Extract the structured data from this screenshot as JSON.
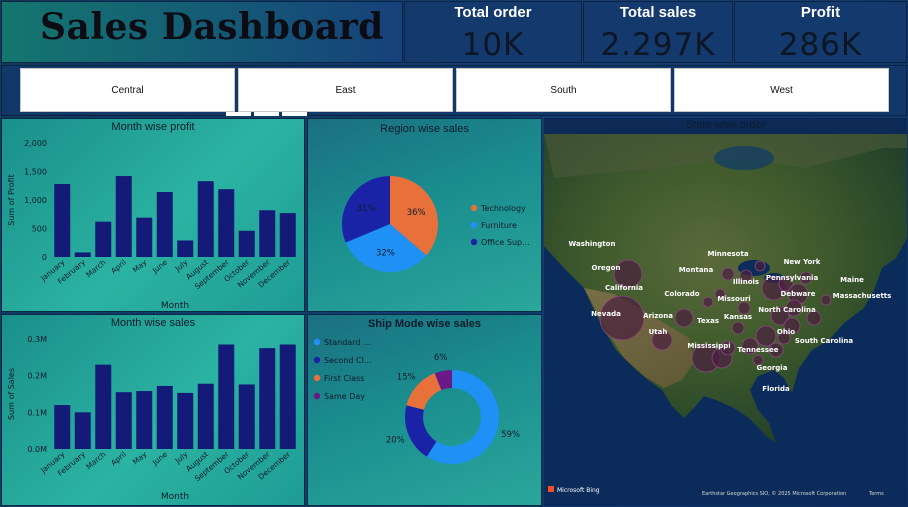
{
  "header": {
    "title": "Sales Dashboard"
  },
  "kpis": [
    {
      "label": "Total order",
      "value": "10K"
    },
    {
      "label": "Total sales",
      "value": "2.297K"
    },
    {
      "label": "Profit",
      "value": "286K"
    }
  ],
  "slicers": [
    "Central",
    "East",
    "South",
    "West"
  ],
  "months": [
    "January",
    "February",
    "March",
    "April",
    "May",
    "June",
    "July",
    "August",
    "September",
    "October",
    "November",
    "December"
  ],
  "chart_data": [
    {
      "type": "bar",
      "title": "Month wise profit",
      "xlabel": "Month",
      "ylabel": "Sum of Profit",
      "categories": [
        "January",
        "February",
        "March",
        "April",
        "May",
        "June",
        "July",
        "August",
        "September",
        "October",
        "November",
        "December"
      ],
      "values": [
        1280,
        80,
        620,
        1420,
        690,
        1140,
        290,
        1330,
        1190,
        460,
        820,
        770
      ],
      "ylim": [
        0,
        2000
      ],
      "yticks": [
        "0",
        "500",
        "1,000",
        "1,500",
        "2,000"
      ],
      "grid": false,
      "color": "#131a78"
    },
    {
      "type": "bar",
      "title": "Month wise sales",
      "xlabel": "Month",
      "ylabel": "Sum of Sales",
      "categories": [
        "January",
        "February",
        "March",
        "April",
        "May",
        "June",
        "July",
        "August",
        "September",
        "October",
        "November",
        "December"
      ],
      "values": [
        0.12,
        0.1,
        0.23,
        0.155,
        0.158,
        0.172,
        0.153,
        0.178,
        0.285,
        0.176,
        0.275,
        0.285
      ],
      "ylim": [
        0,
        0.3
      ],
      "yticks": [
        "0.0M",
        "0.1M",
        "0.2M",
        "0.3M"
      ],
      "grid": false,
      "color": "#131a78"
    },
    {
      "type": "pie",
      "title": "Region wise sales",
      "legend_position": "right",
      "slices": [
        {
          "name": "Technology",
          "label": "36%",
          "value": 36,
          "color": "#e8703a"
        },
        {
          "name": "Furniture",
          "label": "32%",
          "value": 32,
          "color": "#1e90f6"
        },
        {
          "name": "Office Sup...",
          "label": "31%",
          "value": 31,
          "color": "#1a23a6"
        }
      ]
    },
    {
      "type": "pie",
      "subtype": "donut",
      "title": "Ship Mode wise sales",
      "legend_position": "top-left",
      "slices": [
        {
          "name": "Standard ...",
          "label": "59%",
          "value": 59,
          "color": "#1e90f6"
        },
        {
          "name": "Second Cl...",
          "label": "20%",
          "value": 20,
          "color": "#1a23a6"
        },
        {
          "name": "First Class",
          "label": "15%",
          "value": 15,
          "color": "#e8703a"
        },
        {
          "name": "Same Day",
          "label": "6%",
          "value": 6,
          "color": "#6a1a86"
        }
      ]
    }
  ],
  "map": {
    "title": "State wise order",
    "bing_label": "Microsoft Bing",
    "attribution": "Earthstar Geographics SIO, © 2025 Microsoft Corporation",
    "terms_label": "Terms",
    "states": [
      "Washington",
      "Oregon",
      "California",
      "Nevada",
      "Montana",
      "Minnesota",
      "New York",
      "Pennsylvania",
      "Maine",
      "Massachusetts",
      "Illinois",
      "Debware",
      "North Carolina",
      "Colorado",
      "Missouri",
      "Kansas",
      "Arizona",
      "Utah",
      "Texas",
      "Ohio",
      "South Carolina",
      "Tennessee",
      "Mississippi",
      "Georgia",
      "Florida"
    ]
  }
}
